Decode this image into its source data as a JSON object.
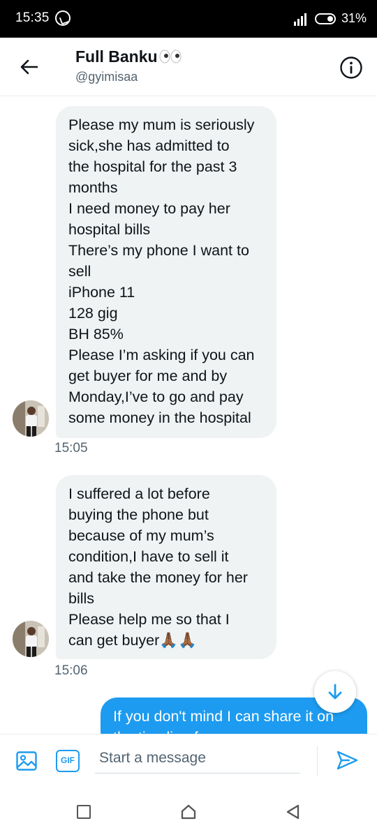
{
  "status_bar": {
    "time": "15:35",
    "battery": "31%"
  },
  "header": {
    "name": "Full Banku",
    "handle": "@gyimisaa"
  },
  "messages": [
    {
      "direction": "incoming",
      "text": "Please my mum is seriously\nsick,she has admitted to\nthe hospital for the past 3\nmonths\nI need money to pay her\nhospital bills\nThere’s my phone I want to\nsell\niPhone 11\n128 gig\nBH 85%\nPlease I’m asking if you can\nget buyer for me and by\nMonday,I’ve to go and pay\nsome money in the hospital",
      "time": "15:05"
    },
    {
      "direction": "incoming",
      "text": "I suffered a lot before\nbuying the phone but\nbecause of my mum’s\ncondition,I have to sell it\nand take the money for her\nbills\nPlease help me so that I\ncan get buyer🙏🏾🙏🏾",
      "time": "15:06"
    },
    {
      "direction": "outgoing",
      "text": "If you don't mind I can share it on the timeline for you"
    }
  ],
  "composer": {
    "placeholder": "Start a message",
    "gif_label": "GIF"
  },
  "colors": {
    "accent": "#1d9bf0",
    "incoming_bubble": "#eff3f4",
    "secondary_text": "#536471"
  },
  "icons": {
    "back": "arrow-left-icon",
    "info": "info-icon",
    "scroll": "arrow-down-icon",
    "media": "image-icon",
    "gif": "gif-icon",
    "send": "send-icon"
  }
}
